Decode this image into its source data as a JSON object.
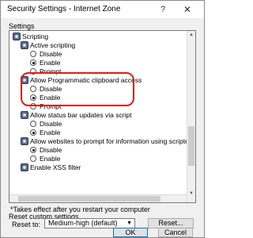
{
  "window": {
    "title": "Security Settings - Internet Zone",
    "help_glyph": "?",
    "close_glyph": "✕"
  },
  "settings": {
    "group_label": "Settings",
    "rows": [
      {
        "text": "Scripting",
        "kind": "category"
      },
      {
        "text": "Active scripting",
        "kind": "setting"
      },
      {
        "text": "Disable",
        "kind": "option",
        "checked": false
      },
      {
        "text": "Enable",
        "kind": "option",
        "checked": true
      },
      {
        "text": "Prompt",
        "kind": "option",
        "checked": false
      },
      {
        "text": "Allow Programmatic clipboard access",
        "kind": "setting"
      },
      {
        "text": "Disable",
        "kind": "option",
        "checked": false
      },
      {
        "text": "Enable",
        "kind": "option",
        "checked": true
      },
      {
        "text": "Prompt",
        "kind": "option",
        "checked": false
      },
      {
        "text": "Allow status bar updates via script",
        "kind": "setting"
      },
      {
        "text": "Disable",
        "kind": "option",
        "checked": false
      },
      {
        "text": "Enable",
        "kind": "option",
        "checked": true
      },
      {
        "text": "Allow websites to prompt for information using scripted windo",
        "kind": "setting"
      },
      {
        "text": "Disable",
        "kind": "option",
        "checked": true
      },
      {
        "text": "Enable",
        "kind": "option",
        "checked": false
      },
      {
        "text": "Enable XSS filter",
        "kind": "setting"
      }
    ]
  },
  "note": "*Takes effect after you restart your computer",
  "reset": {
    "group_label": "Reset custom settings",
    "reset_to_label": "Reset to:",
    "selected": "Medium-high (default)",
    "reset_button": "Reset..."
  },
  "footer": {
    "ok": "OK",
    "cancel": "Cancel"
  },
  "colors": {
    "highlight_ring": "#d91e1e",
    "selection": "#0078d7"
  }
}
